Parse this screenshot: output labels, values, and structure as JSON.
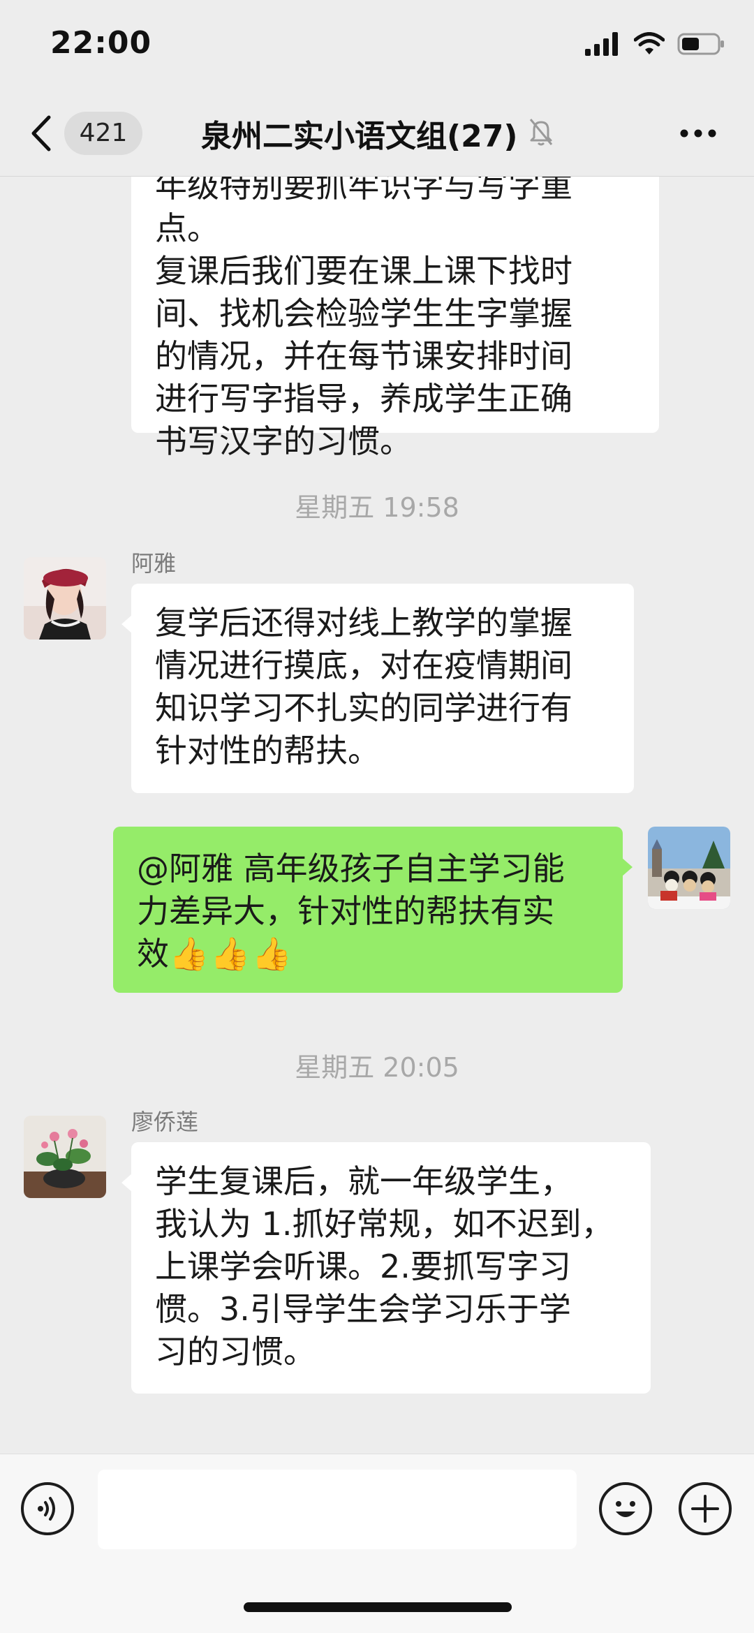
{
  "status_bar": {
    "time": "22:00",
    "icons": [
      "signal-icon",
      "wifi-icon",
      "battery-icon"
    ]
  },
  "nav": {
    "unread_count": "421",
    "title": "泉州二实小语文组(27)",
    "icons": [
      "back-arrow-icon",
      "mute-bell-icon",
      "more-dots-icon"
    ]
  },
  "messages": {
    "m1": {
      "text": "年级特别要抓牢识字与写字重点。\n复课后我们要在课上课下找时\n间、找机会检验学生生字掌握\n的情况，并在每节课安排时间\n进行写字指导，养成学生正确\n书写汉字的习惯。"
    },
    "t1": "星期五 19:58",
    "m2": {
      "sender": "阿雅",
      "text": "复学后还得对线上教学的掌握\n情况进行摸底，对在疫情期间\n知识学习不扎实的同学进行有\n针对性的帮扶。"
    },
    "m3": {
      "text": "@阿雅 高年级孩子自主学习能\n力差异大，针对性的帮扶有实\n效",
      "emoji": "👍👍👍"
    },
    "t2": "星期五 20:05",
    "m4": {
      "sender": "廖侨莲",
      "text": "学生复课后，就一年级学生，\n我认为 1.抓好常规，如不迟到，\n上课学会听课。2.要抓写字习\n惯。3.引导学生会学习乐于学\n习的习惯。"
    }
  },
  "input_bar": {
    "placeholder": "",
    "icons": [
      "voice-icon",
      "emoji-icon",
      "plus-icon"
    ]
  },
  "colors": {
    "background": "#ededed",
    "self_bubble": "#95ec69",
    "other_bubble": "#ffffff",
    "timestamp": "#a8a8a8"
  }
}
